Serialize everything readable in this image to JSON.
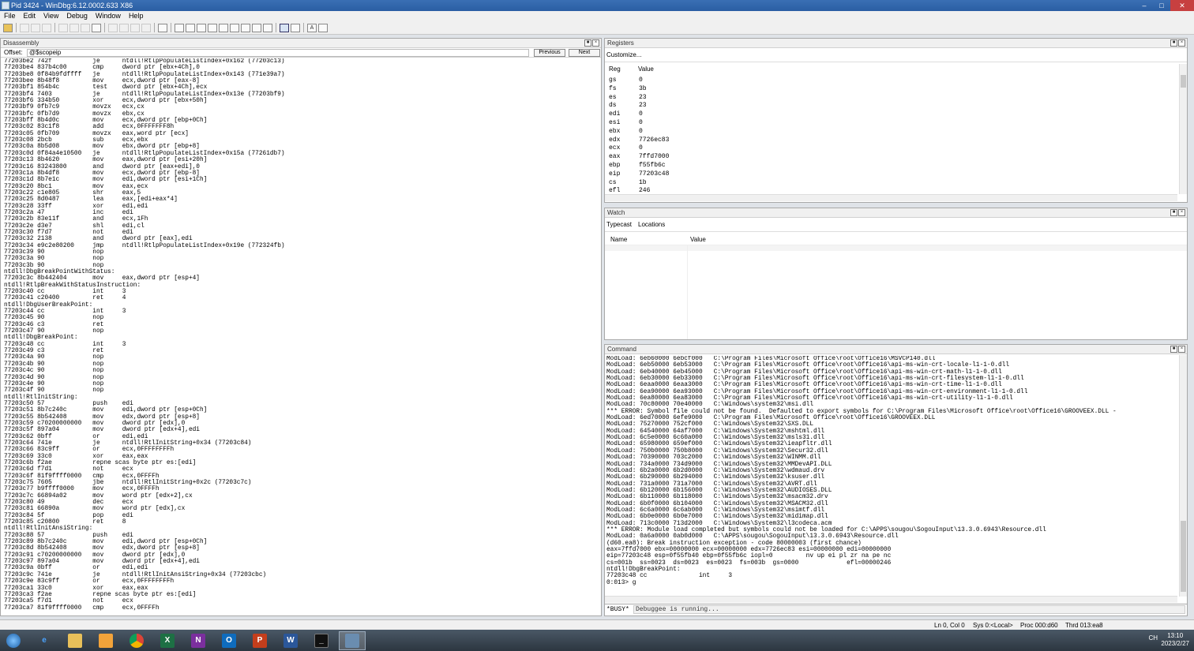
{
  "window": {
    "title": "Pid 3424 - WinDbg:6.12.0002.633 X86"
  },
  "menu": [
    "File",
    "Edit",
    "View",
    "Debug",
    "Window",
    "Help"
  ],
  "disassembly": {
    "title": "Disassembly",
    "offset_label": "Offset:",
    "offset_value": "@$scopeip",
    "previous_label": "Previous",
    "next_label": "Next",
    "lines": [
      "77203be2 742f           je      ntdll!RtlpPopulateListIndex+0x162 (77203c13)",
      "77203be4 837b4c00       cmp     dword ptr [ebx+4Ch],0",
      "77203be8 0f84b9fdffff   je      ntdll!RtlpPopulateListIndex+0x143 (771e39a7)",
      "77203bee 8b48f8         mov     ecx,dword ptr [eax-8]",
      "77203bf1 854b4c         test    dword ptr [ebx+4Ch],ecx",
      "77203bf4 7403           je      ntdll!RtlpPopulateListIndex+0x13e (77203bf9)",
      "77203bf6 334b50         xor     ecx,dword ptr [ebx+50h]",
      "77203bf9 0fb7c9         movzx   ecx,cx",
      "77203bfc 0fb7d9         movzx   ebx,cx",
      "77203bff 8b4d0c         mov     ecx,dword ptr [ebp+0Ch]",
      "77203c02 83c1f8         add     ecx,0FFFFFFF8h",
      "77203c05 0fb709         movzx   eax,word ptr [ecx]",
      "77203c08 2bcb           sub     ecx,ebx",
      "77203c0a 8b5d08         mov     ebx,dword ptr [ebp+8]",
      "77203c0d 0f84a4e10500   je      ntdll!RtlpPopulateListIndex+0x15a (77261db7)",
      "77203c13 8b4620         mov     eax,dword ptr [esi+20h]",
      "77203c16 83243800       and     dword ptr [eax+edi],0",
      "77203c1a 8b4df8         mov     ecx,dword ptr [ebp-8]",
      "77203c1d 8b7e1c         mov     edi,dword ptr [esi+1Ch]",
      "77203c20 8bc1           mov     eax,ecx",
      "77203c22 c1e805         shr     eax,5",
      "77203c25 8d0487         lea     eax,[edi+eax*4]",
      "77203c28 33ff           xor     edi,edi",
      "77203c2a 47             inc     edi",
      "77203c2b 83e11f         and     ecx,1Fh",
      "77203c2e d3e7           shl     edi,cl",
      "77203c30 f7d7           not     edi",
      "77203c32 2138           and     dword ptr [eax],edi",
      "77203c34 e9c2e80200     jmp     ntdll!RtlpPopulateListIndex+0x19e (772324fb)",
      "77203c39 90             nop",
      "77203c3a 90             nop",
      "77203c3b 90             nop",
      "ntdll!DbgBreakPointWithStatus:",
      "77203c3c 8b442404       mov     eax,dword ptr [esp+4]",
      "ntdll!RtlpBreakWithStatusInstruction:",
      "77203c40 cc             int     3",
      "77203c41 c20400         ret     4",
      "ntdll!DbgUserBreakPoint:",
      "77203c44 cc             int     3",
      "77203c45 90             nop",
      "77203c46 c3             ret",
      "77203c47 90             nop",
      "ntdll!DbgBreakPoint:",
      "77203c48 cc             int     3",
      "77203c49 c3             ret",
      "77203c4a 90             nop",
      "77203c4b 90             nop",
      "77203c4c 90             nop",
      "77203c4d 90             nop",
      "77203c4e 90             nop",
      "77203c4f 90             nop",
      "ntdll!RtlInitString:",
      "77203c50 57             push    edi",
      "77203c51 8b7c240c       mov     edi,dword ptr [esp+0Ch]",
      "77203c55 8b542408       mov     edx,dword ptr [esp+8]",
      "77203c59 c70200000000   mov     dword ptr [edx],0",
      "77203c5f 897a04         mov     dword ptr [edx+4],edi",
      "77203c62 0bff           or      edi,edi",
      "77203c64 741e           je      ntdll!RtlInitString+0x34 (77203c84)",
      "77203c66 83c9ff         or      ecx,0FFFFFFFFh",
      "77203c69 33c0           xor     eax,eax",
      "77203c6b f2ae           repne scas byte ptr es:[edi]",
      "77203c6d f7d1           not     ecx",
      "77203c6f 81f9ffff0000   cmp     ecx,0FFFFh",
      "77203c75 7605           jbe     ntdll!RtlInitString+0x2c (77203c7c)",
      "77203c77 b9ffff0000     mov     ecx,0FFFFh",
      "77203c7c 66894a02       mov     word ptr [edx+2],cx",
      "77203c80 49             dec     ecx",
      "77203c81 66890a         mov     word ptr [edx],cx",
      "77203c84 5f             pop     edi",
      "77203c85 c20800         ret     8",
      "ntdll!RtlInitAnsiString:",
      "77203c88 57             push    edi",
      "77203c89 8b7c240c       mov     edi,dword ptr [esp+0Ch]",
      "77203c8d 8b542408       mov     edx,dword ptr [esp+8]",
      "77203c91 c70200000000   mov     dword ptr [edx],0",
      "77203c97 897a04         mov     dword ptr [edx+4],edi",
      "77203c9a 0bff           or      edi,edi",
      "77203c9c 741e           je      ntdll!RtlInitAnsiString+0x34 (77203cbc)",
      "77203c9e 83c9ff         or      ecx,0FFFFFFFFh",
      "77203ca1 33c0           xor     eax,eax",
      "77203ca3 f2ae           repne scas byte ptr es:[edi]",
      "77203ca5 f7d1           not     ecx",
      "77203ca7 81f9ffff0000   cmp     ecx,0FFFFh"
    ]
  },
  "registers": {
    "title": "Registers",
    "customize": "Customize...",
    "col_reg": "Reg",
    "col_value": "Value",
    "rows": [
      [
        "gs",
        "0"
      ],
      [
        "fs",
        "3b"
      ],
      [
        "es",
        "23"
      ],
      [
        "ds",
        "23"
      ],
      [
        "edi",
        "0"
      ],
      [
        "esi",
        "0"
      ],
      [
        "ebx",
        "0"
      ],
      [
        "edx",
        "7726ec83"
      ],
      [
        "ecx",
        "0"
      ],
      [
        "eax",
        "7ffd7000"
      ],
      [
        "ebp",
        "f55fb6c"
      ],
      [
        "eip",
        "77203c48"
      ],
      [
        "cs",
        "1b"
      ],
      [
        "efl",
        "246"
      ]
    ]
  },
  "watch": {
    "title": "Watch",
    "typecast": "Typecast",
    "locations": "Locations",
    "col_name": "Name",
    "col_value": "Value"
  },
  "command": {
    "title": "Command",
    "lines": [
      "ModLoad: 6eb60000 6ebcf000   C:\\Program Files\\Microsoft Office\\root\\Office16\\MSVCP140.dll",
      "ModLoad: 6eb50000 6eb53000   C:\\Program Files\\Microsoft Office\\root\\Office16\\api-ms-win-crt-locale-l1-1-0.dll",
      "ModLoad: 6eb40000 6eb45000   C:\\Program Files\\Microsoft Office\\root\\Office16\\api-ms-win-crt-math-l1-1-0.dll",
      "ModLoad: 6eb30000 6eb33000   C:\\Program Files\\Microsoft Office\\root\\Office16\\api-ms-win-crt-filesystem-l1-1-0.dll",
      "ModLoad: 6eaa0000 6eaa3000   C:\\Program Files\\Microsoft Office\\root\\Office16\\api-ms-win-crt-time-l1-1-0.dll",
      "ModLoad: 6ea90000 6ea93000   C:\\Program Files\\Microsoft Office\\root\\Office16\\api-ms-win-crt-environment-l1-1-0.dll",
      "ModLoad: 6ea80000 6ea83000   C:\\Program Files\\Microsoft Office\\root\\Office16\\api-ms-win-crt-utility-l1-1-0.dll",
      "ModLoad: 70c80000 70e40000   C:\\Windows\\system32\\msi.dll",
      "*** ERROR: Symbol file could not be found.  Defaulted to export symbols for C:\\Program Files\\Microsoft Office\\root\\Office16\\GROOVEEX.DLL -",
      "ModLoad: 6ed70000 6efe9000   C:\\Program Files\\Microsoft Office\\root\\Office16\\GROOVEEX.DLL",
      "ModLoad: 75270000 752cf000   C:\\Windows\\System32\\SXS.DLL",
      "ModLoad: 64540000 64af7000   C:\\Windows\\System32\\mshtml.dll",
      "ModLoad: 6c5e0000 6c60a000   C:\\Windows\\System32\\msls31.dll",
      "ModLoad: 65980000 659ef000   C:\\Windows\\System32\\ieapfltr.dll",
      "ModLoad: 750b0000 750b8000   C:\\Windows\\System32\\Secur32.dll",
      "ModLoad: 70390000 703c2000   C:\\Windows\\System32\\WINMM.dll",
      "ModLoad: 734a0000 734d9000   C:\\Windows\\System32\\MMDevAPI.DLL",
      "ModLoad: 6b2a0000 6b2d0000   C:\\Windows\\System32\\wdmaud.drv",
      "ModLoad: 6b290000 6b294000   C:\\Windows\\System32\\ksuser.dll",
      "ModLoad: 731a0000 731a7000   C:\\Windows\\System32\\AVRT.dll",
      "ModLoad: 6b120000 6b156000   C:\\Windows\\System32\\AUDIOSES.DLL",
      "ModLoad: 6b110000 6b118000   C:\\Windows\\System32\\msacm32.drv",
      "ModLoad: 6b0f0000 6b104000   C:\\Windows\\System32\\MSACM32.dll",
      "ModLoad: 6c6a0000 6c6ab000   C:\\Windows\\System32\\msimtf.dll",
      "ModLoad: 6b0e0000 6b0e7000   C:\\Windows\\System32\\midimap.dll",
      "ModLoad: 713c0000 713d2000   C:\\Windows\\System32\\l3codeca.acm",
      "*** ERROR: Module load completed but symbols could not be loaded for C:\\APPS\\sougou\\SogouInput\\13.3.0.6943\\Resource.dll",
      "ModLoad: 0a6a0000 0ab0d000   C:\\APPS\\sougou\\SogouInput\\13.3.0.6943\\Resource.dll",
      "(d60.ea8): Break instruction exception - code 80000003 (first chance)",
      "eax=7ffd7000 ebx=00000000 ecx=00000000 edx=7726ec83 esi=00000000 edi=00000000",
      "eip=77203c48 esp=0f55fb40 ebp=0f55fb6c iopl=0         nv up ei pl zr na pe nc",
      "cs=001b  ss=0023  ds=0023  es=0023  fs=003b  gs=0000             efl=00000246",
      "ntdll!DbgBreakPoint:",
      "77203c48 cc              int     3",
      "0:013> g"
    ],
    "prompt": "*BUSY*",
    "input_text": "Debuggee is running..."
  },
  "status": {
    "pos": "Ln 0, Col 0",
    "sys": "Sys 0:<Local>",
    "proc": "Proc 000:d60",
    "thrd": "Thrd 013:ea8"
  },
  "tray": {
    "lang": "CH",
    "time": "13:10",
    "date": "2023/2/27"
  }
}
